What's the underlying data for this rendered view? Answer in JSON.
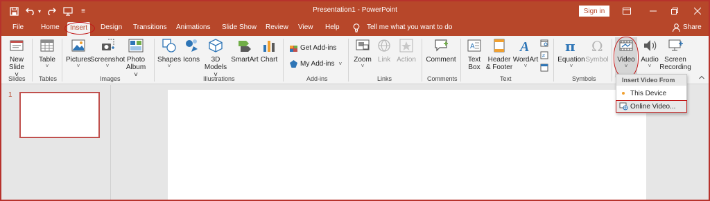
{
  "window": {
    "title": "Presentation1 - PowerPoint",
    "sign_in": "Sign in",
    "qat_more": "≡",
    "colors": {
      "accent": "#b7472a",
      "highlight": "#c21818"
    }
  },
  "tabs": [
    "File",
    "Home",
    "Insert",
    "Design",
    "Transitions",
    "Animations",
    "Slide Show",
    "Review",
    "View",
    "Help"
  ],
  "active_tab": "Insert",
  "tell_me": "Tell me what you want to do",
  "share": "Share",
  "ribbon": {
    "groups": [
      "Slides",
      "Tables",
      "Images",
      "Illustrations",
      "Add-ins",
      "Links",
      "Comments",
      "Text",
      "Symbols"
    ],
    "new_slide": {
      "line1": "New",
      "line2": "Slide ˅"
    },
    "table": {
      "line1": "Table",
      "line2": "˅"
    },
    "pictures": {
      "line1": "Pictures",
      "line2": "˅"
    },
    "screenshot": {
      "line1": "Screenshot",
      "line2": "˅"
    },
    "photo_album": {
      "line1": "Photo",
      "line2": "Album ˅"
    },
    "shapes": {
      "line1": "Shapes",
      "line2": "˅"
    },
    "icons": {
      "line1": "Icons"
    },
    "models": {
      "line1": "3D",
      "line2": "Models ˅"
    },
    "smartart": {
      "line1": "SmartArt"
    },
    "chart": {
      "line1": "Chart"
    },
    "get_addins": "Get Add-ins",
    "my_addins": "My Add-ins",
    "my_addins_caret": "˅",
    "zoom": {
      "line1": "Zoom",
      "line2": "˅"
    },
    "link": {
      "line1": "Link"
    },
    "action": {
      "line1": "Action"
    },
    "comment": {
      "line1": "Comment"
    },
    "text_box": {
      "line1": "Text",
      "line2": "Box"
    },
    "header_footer": {
      "line1": "Header",
      "line2": "& Footer"
    },
    "wordart": {
      "line1": "WordArt",
      "line2": "˅"
    },
    "equation": {
      "line1": "Equation",
      "line2": "˅"
    },
    "symbol": {
      "line1": "Symbol"
    },
    "video": {
      "line1": "Video",
      "line2": "˅"
    },
    "audio": {
      "line1": "Audio",
      "line2": "˅"
    },
    "screen_recording": {
      "line1": "Screen",
      "line2": "Recording"
    }
  },
  "thumbnails": {
    "slide_number": "1"
  },
  "dropdown": {
    "header": "Insert Video From",
    "items": [
      "This Device",
      "Online Video..."
    ],
    "selected_index": 1
  }
}
